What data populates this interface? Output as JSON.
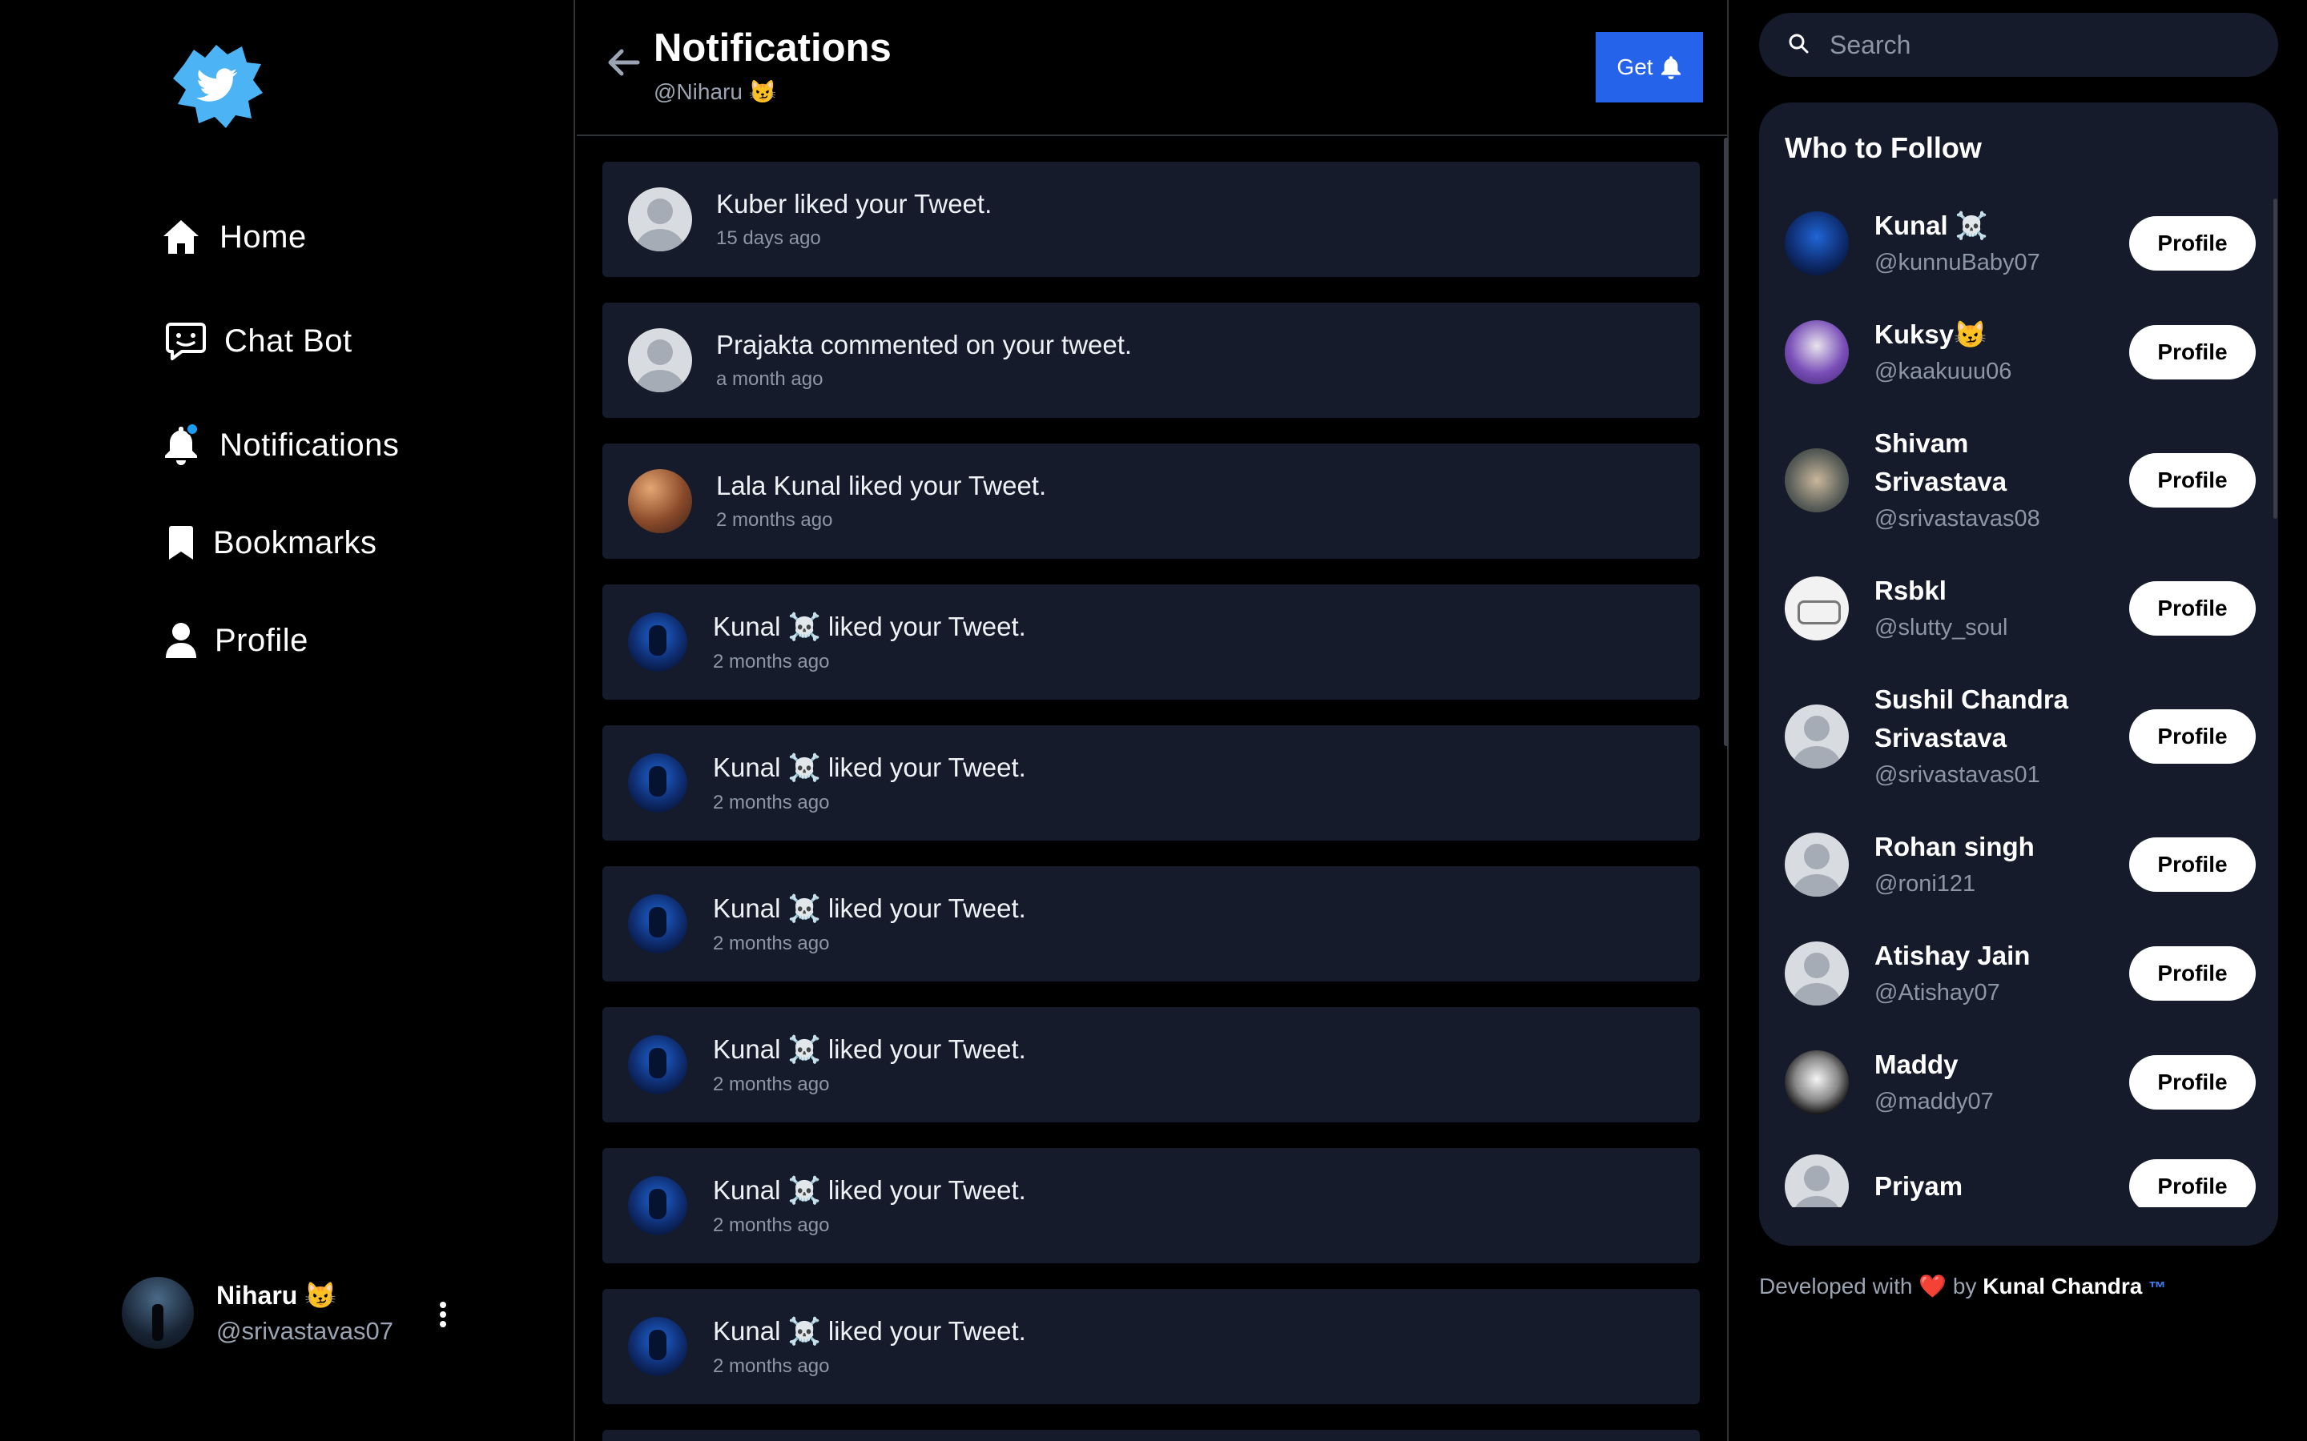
{
  "sidebar": {
    "nav": [
      {
        "label": "Home",
        "icon": "home-icon"
      },
      {
        "label": "Chat Bot",
        "icon": "chat-icon"
      },
      {
        "label": "Notifications",
        "icon": "bell-icon"
      },
      {
        "label": "Bookmarks",
        "icon": "bookmark-icon"
      },
      {
        "label": "Profile",
        "icon": "user-icon"
      }
    ],
    "account": {
      "name": "Niharu 😼",
      "handle": "@srivastavas07"
    }
  },
  "header": {
    "title": "Notifications",
    "subtitle": "@Niharu 😼",
    "get_label": "Get"
  },
  "notifications": [
    {
      "text": "Kuber liked your Tweet.",
      "time": "15 days ago",
      "avatar": "default"
    },
    {
      "text": "Prajakta commented on your tweet.",
      "time": "a month ago",
      "avatar": "default"
    },
    {
      "text": "Lala Kunal liked your Tweet.",
      "time": "2 months ago",
      "avatar": "lala"
    },
    {
      "text": "Kunal ☠️ liked your Tweet.",
      "time": "2 months ago",
      "avatar": "kunal"
    },
    {
      "text": "Kunal ☠️ liked your Tweet.",
      "time": "2 months ago",
      "avatar": "kunal"
    },
    {
      "text": "Kunal ☠️ liked your Tweet.",
      "time": "2 months ago",
      "avatar": "kunal"
    },
    {
      "text": "Kunal ☠️ liked your Tweet.",
      "time": "2 months ago",
      "avatar": "kunal"
    },
    {
      "text": "Kunal ☠️ liked your Tweet.",
      "time": "2 months ago",
      "avatar": "kunal"
    },
    {
      "text": "Kunal ☠️ liked your Tweet.",
      "time": "2 months ago",
      "avatar": "kunal"
    }
  ],
  "search": {
    "placeholder": "Search"
  },
  "who_to_follow": {
    "title": "Who to Follow",
    "button_label": "Profile",
    "users": [
      {
        "name": "Kunal ☠️",
        "handle": "@kunnuBaby07",
        "avatar": "kunal"
      },
      {
        "name": "Kuksy😼",
        "handle": "@kaakuuu06",
        "avatar": "kuksy"
      },
      {
        "name": "Shivam Srivastava",
        "handle": "@srivastavas08",
        "avatar": "shivam"
      },
      {
        "name": "Rsbkl",
        "handle": "@slutty_soul",
        "avatar": "rsbkl"
      },
      {
        "name": "Sushil Chandra Srivastava",
        "handle": "@srivastavas01",
        "avatar": "default"
      },
      {
        "name": "Rohan singh",
        "handle": "@roni121",
        "avatar": "default"
      },
      {
        "name": "Atishay Jain",
        "handle": "@Atishay07",
        "avatar": "default"
      },
      {
        "name": "Maddy",
        "handle": "@maddy07",
        "avatar": "maddy"
      },
      {
        "name": "Priyam",
        "handle": "",
        "avatar": "default"
      }
    ]
  },
  "footer": {
    "prefix": "Developed with",
    "heart": "❤️",
    "by": "by",
    "author": "Kunal Chandra",
    "tm": "™"
  },
  "colors": {
    "accent": "#2563eb",
    "card": "#151b2a",
    "notification_dot": "#1d9bf0",
    "brand": "#4cb3f5"
  }
}
